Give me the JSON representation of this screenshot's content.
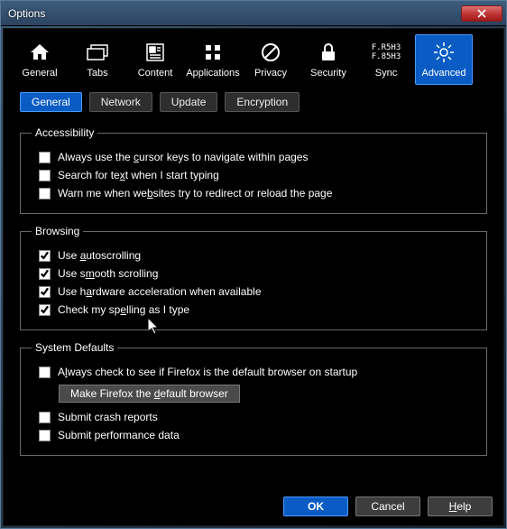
{
  "window": {
    "title": "Options"
  },
  "toolbar": {
    "items": [
      {
        "label": "General"
      },
      {
        "label": "Tabs"
      },
      {
        "label": "Content"
      },
      {
        "label": "Applications"
      },
      {
        "label": "Privacy"
      },
      {
        "label": "Security"
      },
      {
        "label": "Sync"
      },
      {
        "label": "Advanced"
      }
    ],
    "selected": "Advanced"
  },
  "subtabs": {
    "items": [
      "General",
      "Network",
      "Update",
      "Encryption"
    ],
    "selected": "General"
  },
  "groups": {
    "accessibility": {
      "legend": "Accessibility",
      "items": [
        {
          "checked": false,
          "label_pre": "Always use the ",
          "accel": "c",
          "label_post": "ursor keys to navigate within pages"
        },
        {
          "checked": false,
          "label_pre": "Search for te",
          "accel": "x",
          "label_post": "t when I start typing"
        },
        {
          "checked": false,
          "label_pre": "Warn me when we",
          "accel": "b",
          "label_post": "sites try to redirect or reload the page"
        }
      ]
    },
    "browsing": {
      "legend": "Browsing",
      "items": [
        {
          "checked": true,
          "label_pre": "Use ",
          "accel": "a",
          "label_post": "utoscrolling"
        },
        {
          "checked": true,
          "label_pre": "Use s",
          "accel": "m",
          "label_post": "ooth scrolling"
        },
        {
          "checked": true,
          "label_pre": "Use h",
          "accel": "a",
          "label_post": "rdware acceleration when available"
        },
        {
          "checked": true,
          "label_pre": "Check my sp",
          "accel": "e",
          "label_post": "lling as I type"
        }
      ]
    },
    "system_defaults": {
      "legend": "System Defaults",
      "always_check": {
        "checked": false,
        "label_pre": "A",
        "accel": "l",
        "label_post": "ways check to see if Firefox is the default browser on startup"
      },
      "make_default_btn": {
        "label_pre": "Make Firefox the ",
        "accel": "d",
        "label_post": "efault browser"
      },
      "crash_reports": {
        "checked": false,
        "label": "Submit crash reports"
      },
      "perf_data": {
        "checked": false,
        "label": "Submit performance data"
      }
    }
  },
  "buttons": {
    "ok": "OK",
    "cancel": "Cancel",
    "help_pre": "",
    "help_accel": "H",
    "help_post": "elp"
  }
}
